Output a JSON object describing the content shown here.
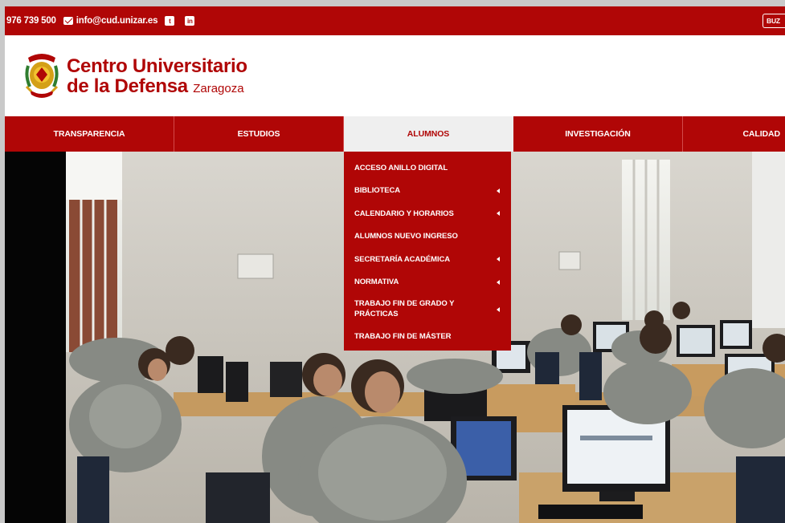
{
  "contact": {
    "phone": "976 739 500",
    "email": "info@cud.unizar.es",
    "social": [
      {
        "name": "twitter-icon",
        "glyph": "t"
      },
      {
        "name": "linkedin-icon",
        "glyph": "in"
      }
    ],
    "buzon_label": "BUZ"
  },
  "brand": {
    "line1": "Centro Universitario",
    "line2": "de la Defensa",
    "city": "Zaragoza",
    "colors": {
      "primary": "#b00606",
      "gold": "#d4a017"
    }
  },
  "nav": {
    "items": [
      {
        "label": "TRANSPARENCIA"
      },
      {
        "label": "ESTUDIOS"
      },
      {
        "label": "ALUMNOS",
        "active": true
      },
      {
        "label": "INVESTIGACIÓN"
      },
      {
        "label": "CALIDAD"
      }
    ]
  },
  "dropdown": {
    "items": [
      {
        "label": "ACCESO ANILLO DIGITAL",
        "submenu": false
      },
      {
        "label": "BIBLIOTECA",
        "submenu": true
      },
      {
        "label": "CALENDARIO Y HORARIOS",
        "submenu": true
      },
      {
        "label": "ALUMNOS NUEVO INGRESO",
        "submenu": false
      },
      {
        "label": "SECRETARÍA ACADÉMICA",
        "submenu": true
      },
      {
        "label": "NORMATIVA",
        "submenu": true
      },
      {
        "label_line1": "TRABAJO FIN DE GRADO Y",
        "label_line2": "PRÁCTICAS",
        "submenu": true
      },
      {
        "label": "TRABAJO FIN DE MÁSTER",
        "submenu": false
      }
    ]
  }
}
